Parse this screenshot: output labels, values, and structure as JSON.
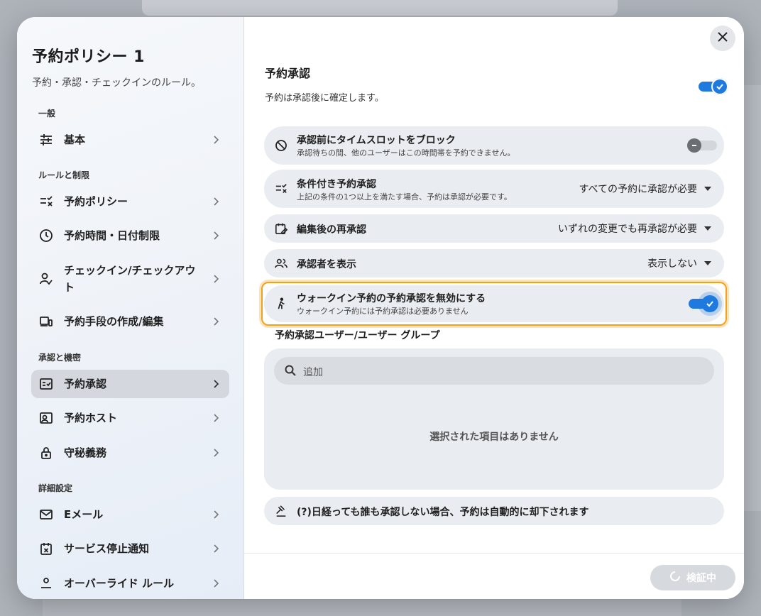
{
  "sidebar": {
    "title": "予約ポリシー 1",
    "subtitle": "予約・承認・チェックインのルール。",
    "sections": {
      "general": "一般",
      "rules": "ルールと制限",
      "approval": "承認と機密",
      "advanced": "詳細設定"
    },
    "items": [
      {
        "label": "基本",
        "icon": "sliders-icon"
      },
      {
        "label": "予約ポリシー",
        "icon": "rule-checklist-icon"
      },
      {
        "label": "予約時間・日付制限",
        "icon": "clock-icon"
      },
      {
        "label": "チェックイン/チェックアウト",
        "icon": "person-check-icon"
      },
      {
        "label": "予約手段の作成/編集",
        "icon": "devices-icon"
      },
      {
        "label": "予約承認",
        "icon": "approval-icon",
        "active": true
      },
      {
        "label": "予約ホスト",
        "icon": "host-badge-icon"
      },
      {
        "label": "守秘義務",
        "icon": "lock-icon"
      },
      {
        "label": "Eメール",
        "icon": "mail-icon"
      },
      {
        "label": "サービス停止通知",
        "icon": "calendar-x-icon"
      },
      {
        "label": "オーバーライド ルール",
        "icon": "override-icon"
      }
    ]
  },
  "main": {
    "title": "予約承認",
    "subtitle": "予約は承認後に確定します。",
    "main_toggle_on": true,
    "rows": [
      {
        "title": "承認前にタイムスロットをブロック",
        "desc": "承認待ちの間、他のユーザーはこの時間帯を予約できません。",
        "toggle_on": false
      },
      {
        "title": "条件付き予約承認",
        "desc": "上記の条件の1つ以上を満たす場合、予約は承認が必要です。",
        "select": "すべての予約に承認が必要"
      },
      {
        "title": "編集後の再承認",
        "select": "いずれの変更でも再承認が必要"
      },
      {
        "title": "承認者を表示",
        "select": "表示しない"
      },
      {
        "title": "ウォークイン予約の予約承認を無効にする",
        "desc": "ウォークイン予約には予約承認は必要ありません",
        "toggle_on": true
      }
    ],
    "group": {
      "title": "予約承認ユーザー/ユーザー グループ",
      "search_placeholder": "追加",
      "empty_text": "選択された項目はありません"
    },
    "auto_reject_text": "(?)日経っても誰も承認しない場合、予約は自動的に却下されます",
    "footer": {
      "verify_label": "検証中"
    }
  },
  "colors": {
    "accent": "#1f7ae0",
    "highlight": "#f2a020"
  }
}
